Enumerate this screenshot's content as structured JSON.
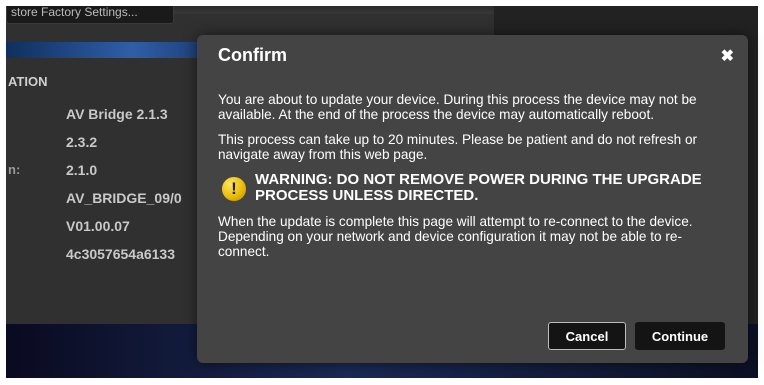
{
  "background": {
    "top_button_label": "store Factory Settings...",
    "section_title": "ATION",
    "rows": [
      {
        "label": "",
        "value": "AV Bridge 2.1.3"
      },
      {
        "label": "",
        "value": "2.3.2"
      },
      {
        "label": "n:",
        "value": "2.1.0"
      },
      {
        "label": "",
        "value": "AV_BRIDGE_09/0"
      },
      {
        "label": "",
        "value": "V01.00.07"
      },
      {
        "label": "",
        "value": "4c3057654a6133"
      }
    ]
  },
  "dialog": {
    "title": "Confirm",
    "close_glyph": "✖",
    "paragraph1": "You are about to update your device. During this process the device may not be available. At the end of the process the device may automatically reboot.",
    "paragraph2": "This process can take up to 20 minutes. Please be patient and do not refresh or navigate away from this web page.",
    "warning_icon_glyph": "!",
    "warning": "WARNING: DO NOT REMOVE POWER DURING THE UPGRADE PROCESS UNLESS DIRECTED.",
    "paragraph3": "When the update is complete this page will attempt to re-connect to the device. Depending on your network and device configuration it may not be able to re-connect.",
    "cancel_label": "Cancel",
    "continue_label": "Continue"
  },
  "colors": {
    "dialog_bg": "#444444",
    "warning_icon": "#e6b800",
    "button_bg": "#141414"
  }
}
